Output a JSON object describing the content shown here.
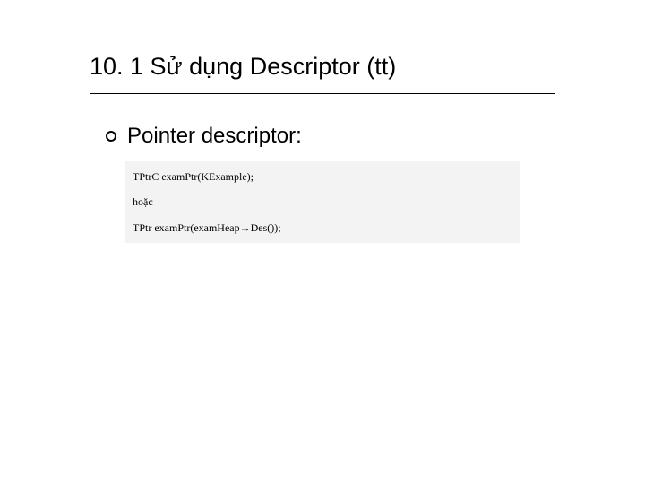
{
  "slide": {
    "title": "10. 1 Sử dụng Descriptor (tt)",
    "bullet": {
      "text": "Pointer descriptor:"
    },
    "code": {
      "line1": "TPtrC examPtr(KExample);",
      "line2": "hoặc",
      "line3": "TPtr examPtr(examHeap→Des());"
    }
  }
}
